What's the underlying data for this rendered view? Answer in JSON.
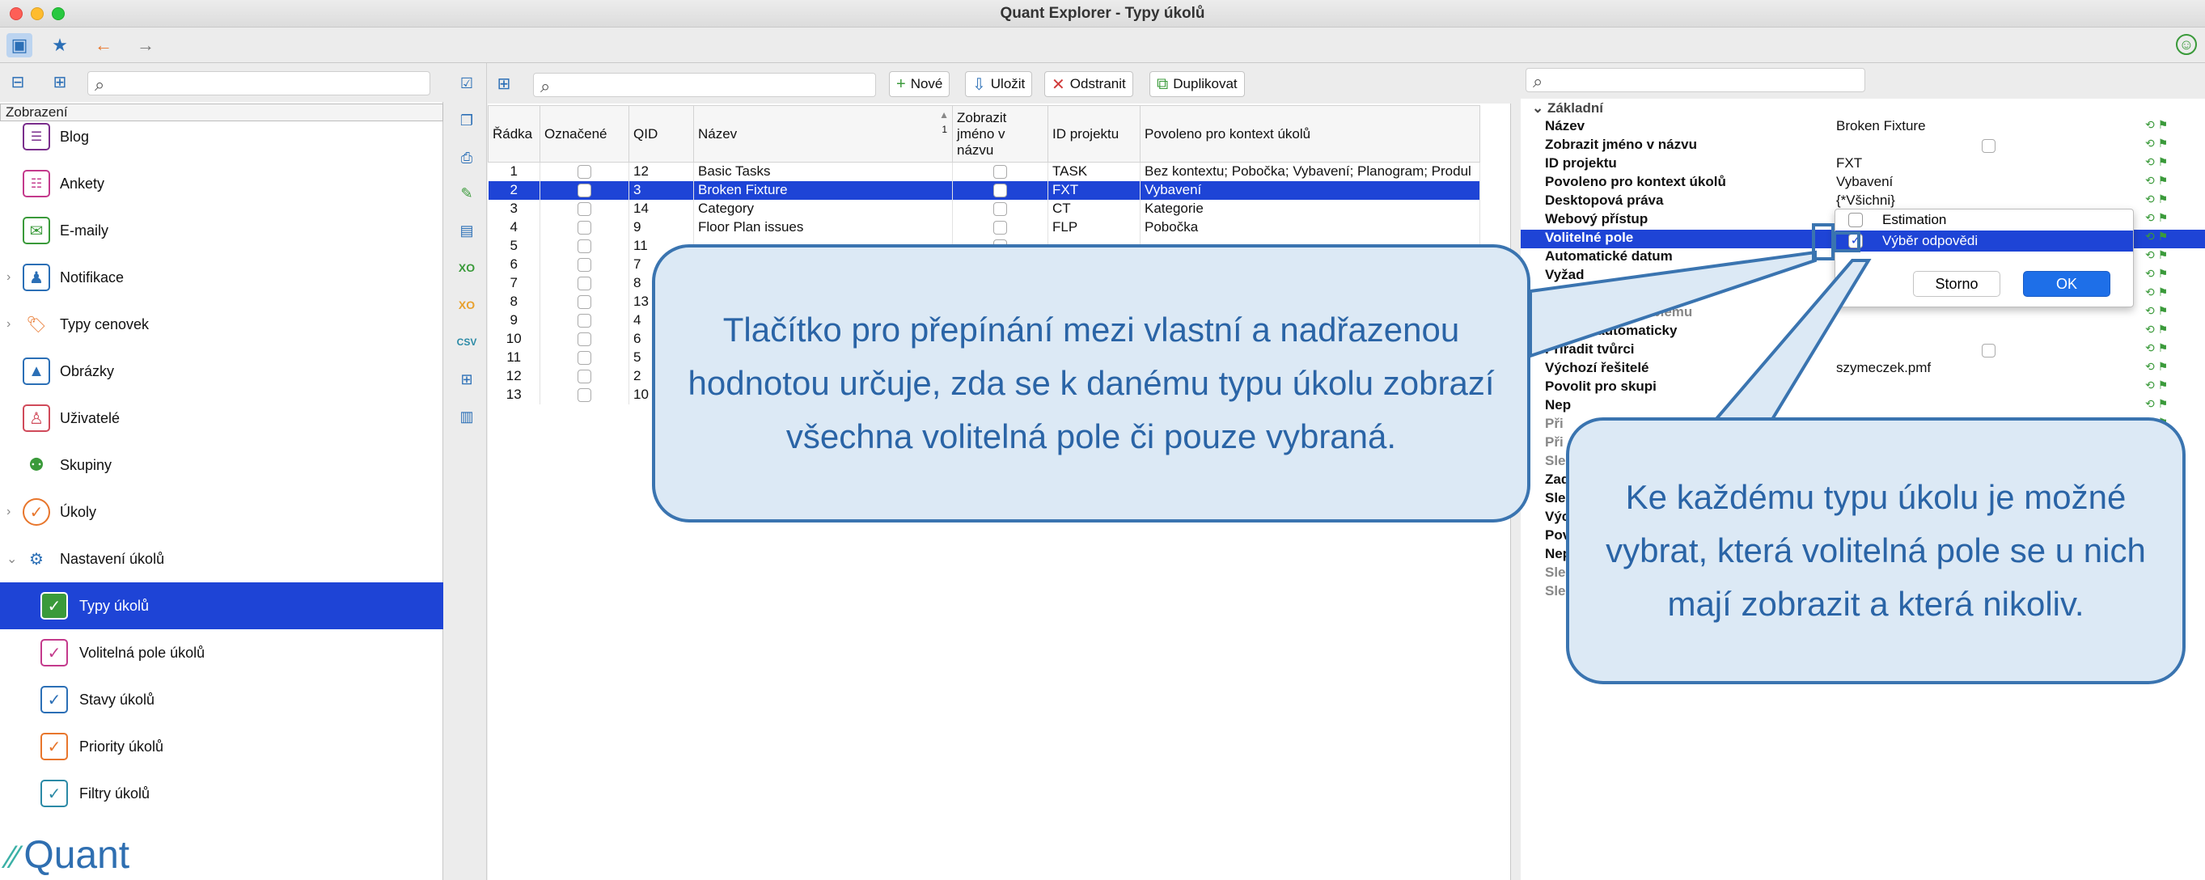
{
  "window": {
    "title": "Quant Explorer - Typy úkolů"
  },
  "left_panel": {
    "section_header": "Zobrazení",
    "items": [
      {
        "label": "Blog",
        "icon": "blog-icon",
        "expandable": false
      },
      {
        "label": "Ankety",
        "icon": "survey-icon",
        "expandable": false
      },
      {
        "label": "E-maily",
        "icon": "email-icon",
        "expandable": false
      },
      {
        "label": "Notifikace",
        "icon": "notification-icon",
        "expandable": true
      },
      {
        "label": "Typy cenovek",
        "icon": "price-tag-icon",
        "expandable": true
      },
      {
        "label": "Obrázky",
        "icon": "image-icon",
        "expandable": false
      },
      {
        "label": "Uživatelé",
        "icon": "user-icon",
        "expandable": false
      },
      {
        "label": "Skupiny",
        "icon": "group-icon",
        "expandable": false
      },
      {
        "label": "Úkoly",
        "icon": "task-icon",
        "expandable": true
      },
      {
        "label": "Nastavení úkolů",
        "icon": "task-settings-icon",
        "expandable": true
      },
      {
        "label": "Typy úkolů",
        "icon": "task-type-icon",
        "selected": true
      },
      {
        "label": "Volitelná pole úkolů",
        "icon": "optional-fields-icon"
      },
      {
        "label": "Stavy úkolů",
        "icon": "task-status-icon"
      },
      {
        "label": "Priority úkolů",
        "icon": "task-priority-icon"
      },
      {
        "label": "Filtry úkolů",
        "icon": "task-filter-icon"
      }
    ],
    "logo_text": "Quant"
  },
  "mid_toolbar": {
    "new_label": "Nové",
    "save_label": "Uložit",
    "delete_label": "Odstranit",
    "duplicate_label": "Duplikovat"
  },
  "grid": {
    "columns": [
      "Řádka",
      "Označené",
      "QID",
      "Název",
      "Zobrazit jméno v názvu",
      "ID projektu",
      "Povoleno pro kontext úkolů"
    ],
    "sort_indicator": "1",
    "rows": [
      {
        "row": "1",
        "qid": "12",
        "name": "Basic Tasks",
        "project": "TASK",
        "context": "Bez kontextu; Pobočka; Vybavení; Planogram; Produl"
      },
      {
        "row": "2",
        "qid": "3",
        "name": "Broken Fixture",
        "project": "FXT",
        "context": "Vybavení",
        "selected": true
      },
      {
        "row": "3",
        "qid": "14",
        "name": "Category",
        "project": "CT",
        "context": "Kategorie"
      },
      {
        "row": "4",
        "qid": "9",
        "name": "Floor Plan issues",
        "project": "FLP",
        "context": "Pobočka"
      },
      {
        "row": "5",
        "qid": "11",
        "name": "",
        "project": "",
        "context": ""
      },
      {
        "row": "6",
        "qid": "7",
        "name": "",
        "project": "",
        "context": ""
      },
      {
        "row": "7",
        "qid": "8",
        "name": "",
        "project": "",
        "context": ""
      },
      {
        "row": "8",
        "qid": "13",
        "name": "",
        "project": "",
        "context": ""
      },
      {
        "row": "9",
        "qid": "4",
        "name": "",
        "project": "",
        "context": ""
      },
      {
        "row": "10",
        "qid": "6",
        "name": "",
        "project": "",
        "context": ""
      },
      {
        "row": "11",
        "qid": "5",
        "name": "",
        "project": "",
        "context": ""
      },
      {
        "row": "12",
        "qid": "2",
        "name": "",
        "project": "",
        "context": ""
      },
      {
        "row": "13",
        "qid": "10",
        "name": "",
        "project": "",
        "context": ""
      }
    ]
  },
  "properties": {
    "section_basic": "Základní",
    "rows": [
      {
        "name": "Název",
        "value": "Broken Fixture"
      },
      {
        "name": "Zobrazit jméno v názvu",
        "value": ""
      },
      {
        "name": "ID projektu",
        "value": "FXT"
      },
      {
        "name": "Povoleno pro kontext úkolů",
        "value": "Vybavení"
      },
      {
        "name": "Desktopová práva",
        "value": "{*Všichni}"
      },
      {
        "name": "Webový přístup",
        "value": ""
      },
      {
        "name": "Volitelné pole",
        "value": ""
      },
      {
        "name": "Automatické datum",
        "value": ""
      },
      {
        "name": "Vyžad",
        "value": ""
      },
      {
        "name": "chválení planogram",
        "value": ""
      },
      {
        "name": "it při hlášení problému",
        "value": ""
      },
      {
        "name": "Přiřadit automaticky",
        "value": ""
      },
      {
        "name": "Přiřadit tvůrci",
        "value": ""
      },
      {
        "name": "Výchozí řešitelé",
        "value": "szymeczek.pmf"
      },
      {
        "name": "Povolit pro skupi",
        "value": ""
      },
      {
        "name": "Nep",
        "value": ""
      },
      {
        "name": "Při",
        "value": ""
      },
      {
        "name": "Při",
        "value": ""
      },
      {
        "name": "Sle",
        "value": ""
      },
      {
        "name": "Zad",
        "value": ""
      },
      {
        "name": "Sle",
        "value": ""
      },
      {
        "name": "Výc",
        "value": ""
      },
      {
        "name": "Pov",
        "value": ""
      },
      {
        "name": "Nep",
        "value": ""
      },
      {
        "name": "Sle",
        "value": ""
      },
      {
        "name": "Sle",
        "value": ""
      }
    ]
  },
  "popup": {
    "options": [
      {
        "label": "Estimation",
        "checked": false
      },
      {
        "label": "Výběr odpovědi",
        "checked": true
      }
    ],
    "cancel_label": "Storno",
    "ok_label": "OK"
  },
  "callouts": {
    "left_text": "Tlačítko pro přepínání mezi vlastní a nadřazenou hodnotou určuje, zda se k danému typu úkolu zobrazí všechna volitelná pole či pouze vybraná.",
    "right_text": "Ke každému typu úkolu je možné vybrat, která volitelná pole se u nich mají zobrazit a která nikoliv."
  },
  "colors": {
    "selection": "#1e44d6",
    "callout_border": "#3a74b0",
    "callout_fill": "#dce9f5",
    "callout_text": "#2a64a6",
    "ok_button": "#1e6fe8"
  }
}
